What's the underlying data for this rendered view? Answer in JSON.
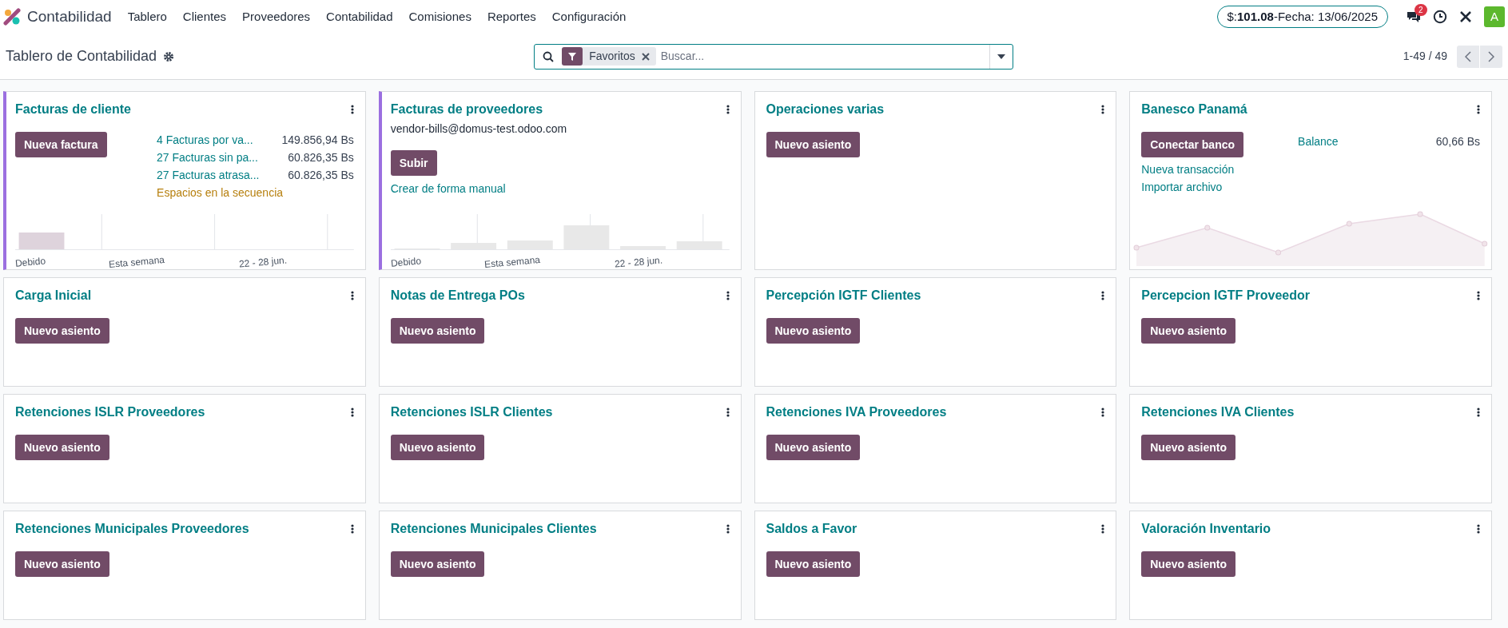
{
  "navbar": {
    "app_name": "Contabilidad",
    "menu": [
      "Tablero",
      "Clientes",
      "Proveedores",
      "Contabilidad",
      "Comisiones",
      "Reportes",
      "Configuración"
    ],
    "rate": "$:**101.08**-Fecha: 13/06/2025",
    "messages_count": "2",
    "avatar": "A"
  },
  "control_panel": {
    "title": "Tablero de Contabilidad",
    "search": {
      "facet": "Favoritos",
      "placeholder": "Buscar..."
    },
    "pager": "1-49 / 49"
  },
  "cards": [
    {
      "kind": "sale",
      "title": "Facturas de cliente",
      "highlighted": true,
      "button": "Nueva factura",
      "stats": [
        {
          "label": "4 Facturas por va...",
          "amount": "149.856,94 Bs"
        },
        {
          "label": "27 Facturas sin pa...",
          "amount": "60.826,35 Bs"
        },
        {
          "label": "27 Facturas atrasa...",
          "amount": "60.826,35 Bs"
        }
      ],
      "warning": "Espacios en la secuencia",
      "chart_labels": [
        "Debido",
        "Esta semana",
        "22 - 28 jun."
      ]
    },
    {
      "kind": "purchase",
      "title": "Facturas de proveedores",
      "highlighted": true,
      "email": "vendor-bills@domus-test.odoo.com",
      "button": "Subir",
      "link": "Crear de forma manual",
      "chart_labels": [
        "Debido",
        "Esta semana",
        "22 - 28 jun."
      ]
    },
    {
      "kind": "general",
      "title": "Operaciones varias",
      "highlighted": false,
      "button": "Nuevo asiento"
    },
    {
      "kind": "bank",
      "title": "Banesco Panamá",
      "highlighted": false,
      "button": "Conectar banco",
      "links": [
        "Nueva transacción",
        "Importar archivo"
      ],
      "balance_label": "Balance",
      "balance": "60,66 Bs"
    },
    {
      "kind": "general",
      "title": "Carga Inicial",
      "highlighted": false,
      "button": "Nuevo asiento"
    },
    {
      "kind": "general",
      "title": "Notas de Entrega POs",
      "highlighted": false,
      "button": "Nuevo asiento"
    },
    {
      "kind": "general",
      "title": "Percepción IGTF Clientes",
      "highlighted": false,
      "button": "Nuevo asiento"
    },
    {
      "kind": "general",
      "title": "Percepcion IGTF Proveedor",
      "highlighted": false,
      "button": "Nuevo asiento"
    },
    {
      "kind": "general",
      "title": "Retenciones ISLR Proveedores",
      "highlighted": false,
      "button": "Nuevo asiento"
    },
    {
      "kind": "general",
      "title": "Retenciones ISLR Clientes",
      "highlighted": false,
      "button": "Nuevo asiento"
    },
    {
      "kind": "general",
      "title": "Retenciones IVA Proveedores",
      "highlighted": false,
      "button": "Nuevo asiento"
    },
    {
      "kind": "general",
      "title": "Retenciones IVA Clientes",
      "highlighted": false,
      "button": "Nuevo asiento"
    },
    {
      "kind": "general",
      "title": "Retenciones Municipales Proveedores",
      "highlighted": false,
      "button": "Nuevo asiento"
    },
    {
      "kind": "general",
      "title": "Retenciones Municipales Clientes",
      "highlighted": false,
      "button": "Nuevo asiento"
    },
    {
      "kind": "general",
      "title": "Saldos a Favor",
      "highlighted": false,
      "button": "Nuevo asiento"
    },
    {
      "kind": "general",
      "title": "Valoración Inventario",
      "highlighted": false,
      "button": "Nuevo asiento"
    }
  ]
}
